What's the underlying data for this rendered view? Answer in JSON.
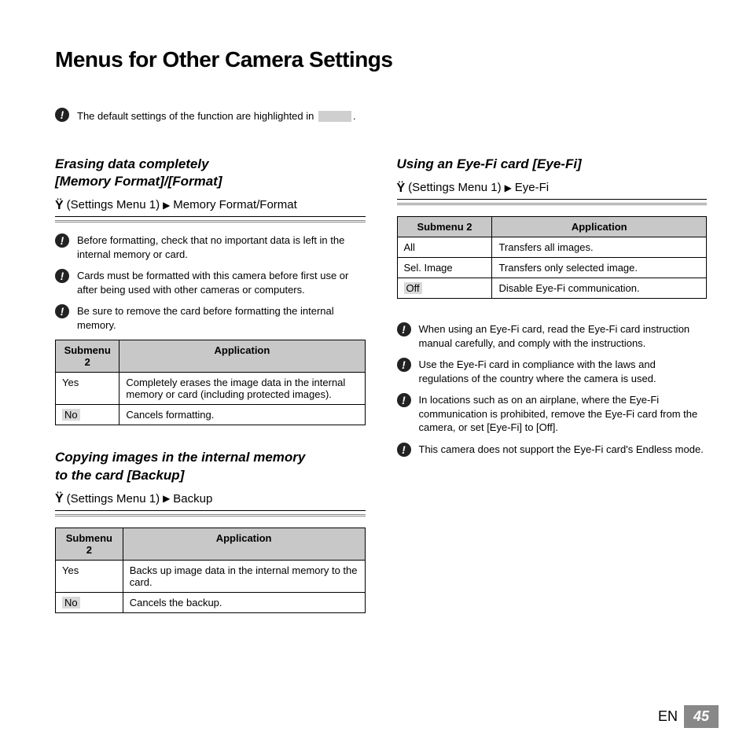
{
  "title": "Menus for Other Camera Settings",
  "intro_note_prefix": "The default settings of the function are highlighted in ",
  "intro_note_suffix": ".",
  "sections": {
    "memory_format": {
      "heading_l1": "Erasing data completely",
      "heading_l2": "[Memory Format]/[Format]",
      "menu_label": "(Settings Menu 1)",
      "menu_target": "Memory Format/Format",
      "notes": [
        "Before formatting, check that no important data is left in the internal memory or card.",
        "Cards must be formatted with this camera before first use or after being used with other cameras or computers.",
        "Be sure to remove the card before formatting the internal memory."
      ],
      "table": {
        "headers": [
          "Submenu 2",
          "Application"
        ],
        "rows": [
          {
            "opt": "Yes",
            "default": false,
            "app": "Completely erases the image data in the internal memory or card (including protected images)."
          },
          {
            "opt": "No",
            "default": true,
            "app": "Cancels formatting."
          }
        ]
      }
    },
    "backup": {
      "heading_l1": "Copying images in the internal memory",
      "heading_l2": "to the card [Backup]",
      "menu_label": "(Settings Menu 1)",
      "menu_target": "Backup",
      "table": {
        "headers": [
          "Submenu 2",
          "Application"
        ],
        "rows": [
          {
            "opt": "Yes",
            "default": false,
            "app": "Backs up image data in the internal memory to the card."
          },
          {
            "opt": "No",
            "default": true,
            "app": "Cancels the backup."
          }
        ]
      }
    },
    "eyefi": {
      "heading_l1": "Using an Eye-Fi card [Eye-Fi]",
      "menu_label": "(Settings Menu 1)",
      "menu_target": "Eye-Fi",
      "table": {
        "headers": [
          "Submenu 2",
          "Application"
        ],
        "rows": [
          {
            "opt": "All",
            "default": false,
            "app": "Transfers all images."
          },
          {
            "opt": "Sel. Image",
            "default": false,
            "app": "Transfers only selected image."
          },
          {
            "opt": "Off",
            "default": true,
            "app": "Disable Eye-Fi communication."
          }
        ]
      },
      "notes": [
        "When using an Eye-Fi card, read the Eye-Fi card instruction manual carefully, and comply with the instructions.",
        "Use the Eye-Fi card in compliance with the laws and regulations of the country where the camera is used.",
        "In locations such as on an airplane, where the Eye-Fi communication is prohibited, remove the Eye-Fi card from the camera, or set [Eye-Fi] to [Off].",
        "This camera does not support the Eye-Fi card's Endless mode."
      ]
    }
  },
  "footer": {
    "lang": "EN",
    "page": "45"
  },
  "glyphs": {
    "arrow": "▶"
  }
}
